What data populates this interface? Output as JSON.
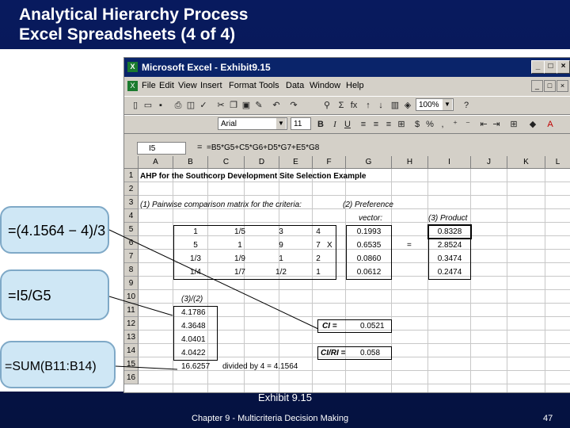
{
  "slide": {
    "title_line1": "Analytical Hierarchy Process",
    "title_line2": "Excel Spreadsheets (4 of 4)",
    "caption": "Exhibit 9.15",
    "footer": "Chapter 9 - Multicriteria Decision Making",
    "page_number": "47"
  },
  "window": {
    "title": "Microsoft Excel - Exhibit9.15",
    "min": "_",
    "max": "□",
    "close": "×"
  },
  "menu": [
    "File",
    "Edit",
    "View",
    "Insert",
    "Format",
    "Tools",
    "Data",
    "Window",
    "Help"
  ],
  "toolbar": {
    "zoom": "100%",
    "font_name": "Arial",
    "font_size": "11",
    "bold": "B",
    "italic": "I",
    "underline": "U",
    "currency": "$",
    "percent": "%",
    "sum": "Σ",
    "fx": "fx",
    "help": "?"
  },
  "formula_bar": {
    "name_box": "I5",
    "equals": "=",
    "formula": "=B5*G5+C5*G6+D5*G7+E5*G8"
  },
  "columns": [
    "A",
    "B",
    "C",
    "D",
    "E",
    "F",
    "G",
    "H",
    "I",
    "J",
    "K",
    "L"
  ],
  "rows": [
    "1",
    "2",
    "3",
    "4",
    "5",
    "6",
    "7",
    "8",
    "9",
    "10",
    "11",
    "12",
    "13",
    "14",
    "15",
    "16"
  ],
  "sheet": {
    "title": "AHP for the Southcorp Development Site Selection Example",
    "label_pairwise": "(1) Pairwise comparison matrix for the criteria:",
    "label_pref_1": "(2) Preference",
    "label_pref_2": "vector:",
    "label_product": "(3) Product",
    "matrix": [
      [
        "1",
        "1/5",
        "3",
        "4"
      ],
      [
        "5",
        "1",
        "9",
        "7"
      ],
      [
        "1/3",
        "1/9",
        "1",
        "2"
      ],
      [
        "1/4",
        "1/7",
        "1/2",
        "1"
      ]
    ],
    "x_symbol": "X",
    "eq_symbol": "=",
    "preference": [
      "0.1993",
      "0.6535",
      "0.0860",
      "0.0612"
    ],
    "product": [
      "0.8328",
      "2.8524",
      "0.3474",
      "0.2474"
    ],
    "label_ratio": "(3)/(2)",
    "ratios": [
      "4.1786",
      "4.3648",
      "4.0401",
      "4.0422"
    ],
    "sum": "16.6257",
    "divided_note": "divided by 4 = 4.1564",
    "ci_label": "CI =",
    "ci_value": "0.0521",
    "cr_label": "CI/RI =",
    "cr_value": "0.058"
  },
  "callouts": {
    "ci_formula": "=(4.1564 − 4)/3",
    "ratio_formula": "=I5/G5",
    "sum_formula": "=SUM(B11:B14)"
  }
}
